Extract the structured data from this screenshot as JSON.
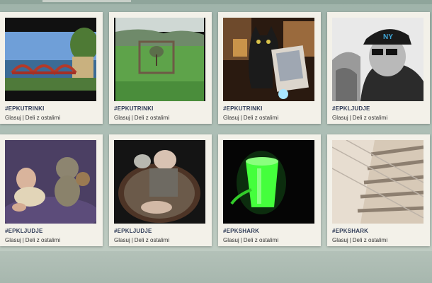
{
  "gallery": {
    "items": [
      {
        "tag": "#EPKUTRINKI",
        "like": "Glasuj",
        "separator": "|",
        "share": "Deli z ostalimi",
        "image": "river-bridge-photo"
      },
      {
        "tag": "#EPKUTRINKI",
        "like": "Glasuj",
        "separator": "|",
        "share": "Deli z ostalimi",
        "image": "field-frame-tree-photo"
      },
      {
        "tag": "#EPKUTRINKI",
        "like": "Glasuj",
        "separator": "|",
        "share": "Deli z ostalimi",
        "image": "cat-laptop-photo"
      },
      {
        "tag": "#EPKLJUDJE",
        "like": "Glasuj",
        "separator": "|",
        "share": "Deli z ostalimi",
        "image": "man-cap-sunglasses-photo"
      },
      {
        "tag": "#EPKLJUDJE",
        "like": "Glasuj",
        "separator": "|",
        "share": "Deli z ostalimi",
        "image": "baby-teddy-bear-photo"
      },
      {
        "tag": "#EPKLJUDJE",
        "like": "Glasuj",
        "separator": "|",
        "share": "Deli z ostalimi",
        "image": "baby-basket-photo"
      },
      {
        "tag": "#EPKSHARK",
        "like": "Glasuj",
        "separator": "|",
        "share": "Deli z ostalimi",
        "image": "green-glowing-glass-photo"
      },
      {
        "tag": "#EPKSHARK",
        "like": "Glasuj",
        "separator": "|",
        "share": "Deli z ostalimi",
        "image": "building-balconies-photo"
      }
    ]
  }
}
